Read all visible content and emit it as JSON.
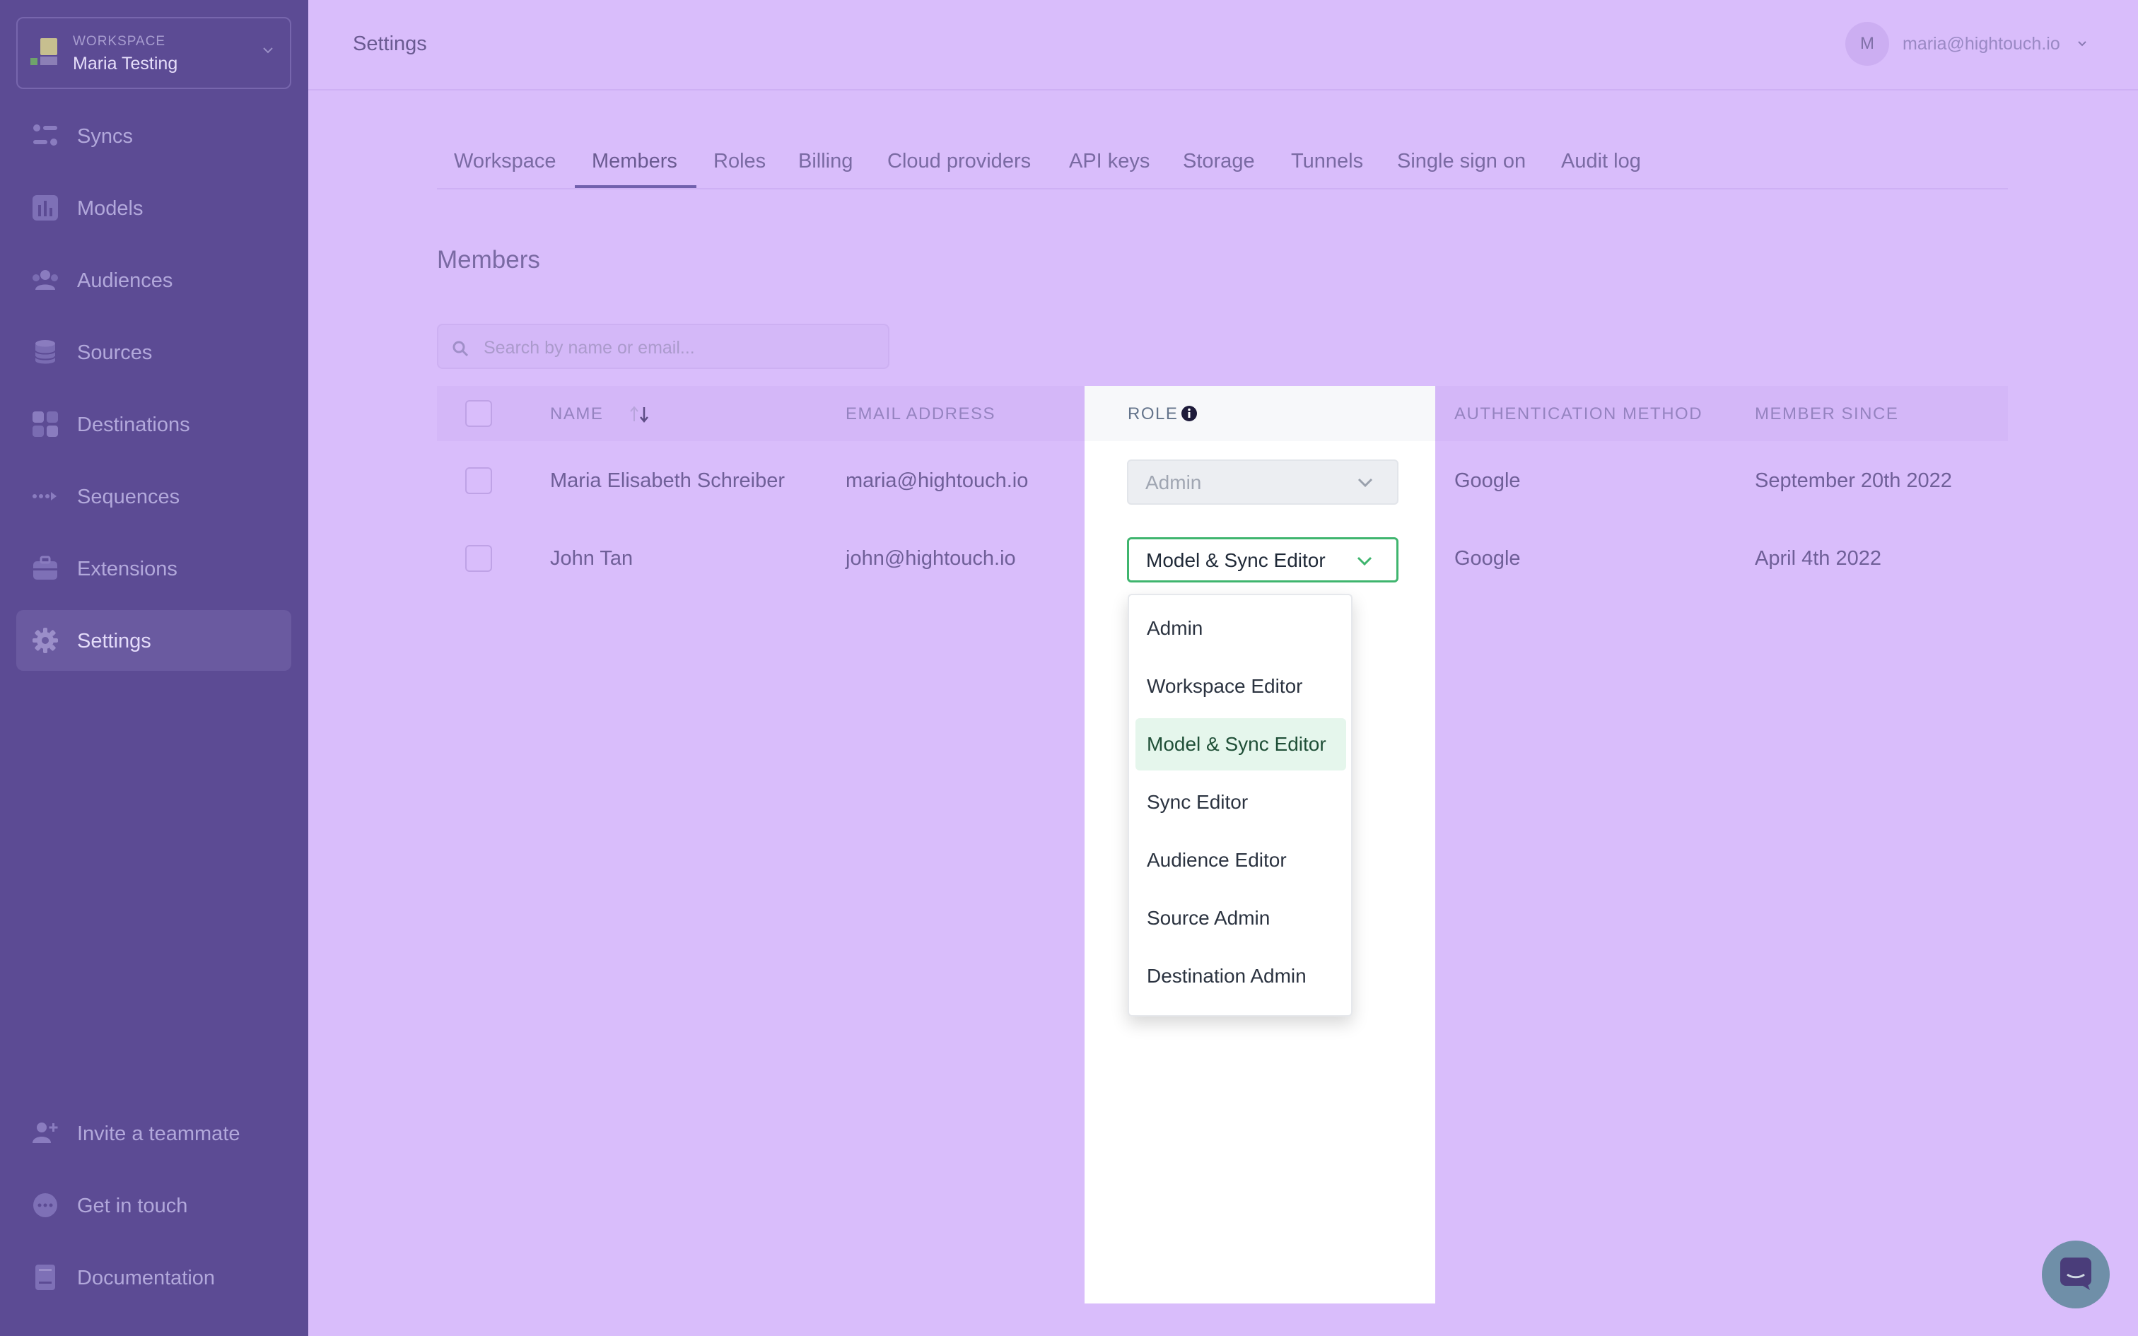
{
  "workspace": {
    "caption": "WORKSPACE",
    "name": "Maria Testing"
  },
  "sidebar": {
    "items": [
      {
        "label": "Syncs",
        "icon": "syncs-icon"
      },
      {
        "label": "Models",
        "icon": "models-icon"
      },
      {
        "label": "Audiences",
        "icon": "audiences-icon"
      },
      {
        "label": "Sources",
        "icon": "sources-icon"
      },
      {
        "label": "Destinations",
        "icon": "destinations-icon"
      },
      {
        "label": "Sequences",
        "icon": "sequences-icon"
      },
      {
        "label": "Extensions",
        "icon": "extensions-icon"
      },
      {
        "label": "Settings",
        "icon": "settings-icon",
        "active": true
      }
    ],
    "bottom": [
      {
        "label": "Invite a teammate",
        "icon": "invite-icon"
      },
      {
        "label": "Get in touch",
        "icon": "chat-icon"
      },
      {
        "label": "Documentation",
        "icon": "documentation-icon"
      }
    ]
  },
  "header": {
    "title": "Settings",
    "avatar_initial": "M",
    "user_email": "maria@hightouch.io"
  },
  "tabs": [
    {
      "label": "Workspace"
    },
    {
      "label": "Members",
      "active": true
    },
    {
      "label": "Roles"
    },
    {
      "label": "Billing"
    },
    {
      "label": "Cloud providers"
    },
    {
      "label": "API keys"
    },
    {
      "label": "Storage"
    },
    {
      "label": "Tunnels"
    },
    {
      "label": "Single sign on"
    },
    {
      "label": "Audit log"
    }
  ],
  "members": {
    "title": "Members",
    "search_placeholder": "Search by name or email...",
    "columns": {
      "name": "NAME",
      "email": "EMAIL ADDRESS",
      "role": "ROLE",
      "auth": "AUTHENTICATION METHOD",
      "since": "MEMBER SINCE"
    },
    "rows": [
      {
        "name": "Maria Elisabeth Schreiber",
        "email": "maria@hightouch.io",
        "role": "Admin",
        "role_disabled": true,
        "auth": "Google",
        "since": "September 20th 2022"
      },
      {
        "name": "John Tan",
        "email": "john@hightouch.io",
        "role": "Model & Sync Editor",
        "role_disabled": false,
        "auth": "Google",
        "since": "April 4th 2022"
      }
    ]
  },
  "role_menu": {
    "options": [
      "Admin",
      "Workspace Editor",
      "Model & Sync Editor",
      "Sync Editor",
      "Audience Editor",
      "Source Admin",
      "Destination Admin"
    ],
    "selected": "Model & Sync Editor"
  },
  "colors": {
    "accent_green": "#3fb56e",
    "sidebar_bg": "#5c4b94",
    "page_bg": "#d9bdfb"
  }
}
